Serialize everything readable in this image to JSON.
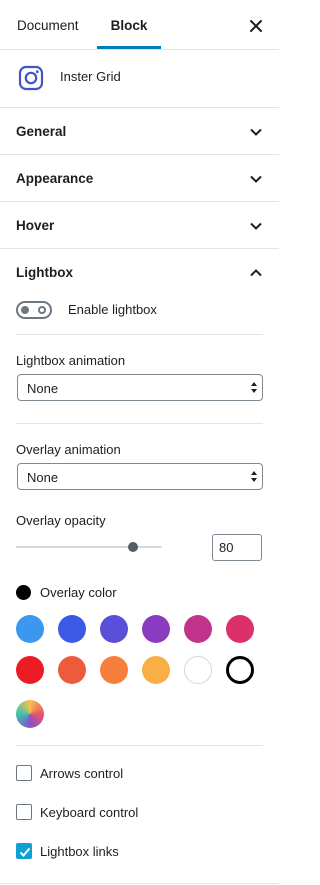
{
  "tabs": {
    "document": "Document",
    "block": "Block"
  },
  "block_card": {
    "name": "Inster Grid",
    "icon": "instagram-icon"
  },
  "panels": {
    "general": "General",
    "appearance": "Appearance",
    "hover": "Hover"
  },
  "lightbox": {
    "title": "Lightbox",
    "enable_label": "Enable lightbox",
    "enabled": false,
    "animation_label": "Lightbox animation",
    "animation_value": "None",
    "overlay_animation_label": "Overlay animation",
    "overlay_animation_value": "None",
    "overlay_opacity_label": "Overlay opacity",
    "overlay_opacity_value": "80",
    "overlay_opacity_max": 100,
    "overlay_color_label": "Overlay color",
    "overlay_color_value": "#000000",
    "palette": [
      "#3a98ee",
      "#3d5ae6",
      "#5a4fd8",
      "#8a3bbf",
      "#c2338c",
      "#dc2f6b",
      "#ec1c24",
      "#ee5a3c",
      "#f6803b",
      "#f9ae47",
      "#ffffff",
      "#000000"
    ],
    "gradient_swatch": [
      "#f7c04a",
      "#e8556b",
      "#8a4fc8",
      "#3ec3b0"
    ],
    "arrows_label": "Arrows control",
    "arrows_checked": false,
    "keyboard_label": "Keyboard control",
    "keyboard_checked": false,
    "links_label": "Lightbox links",
    "links_checked": true
  }
}
